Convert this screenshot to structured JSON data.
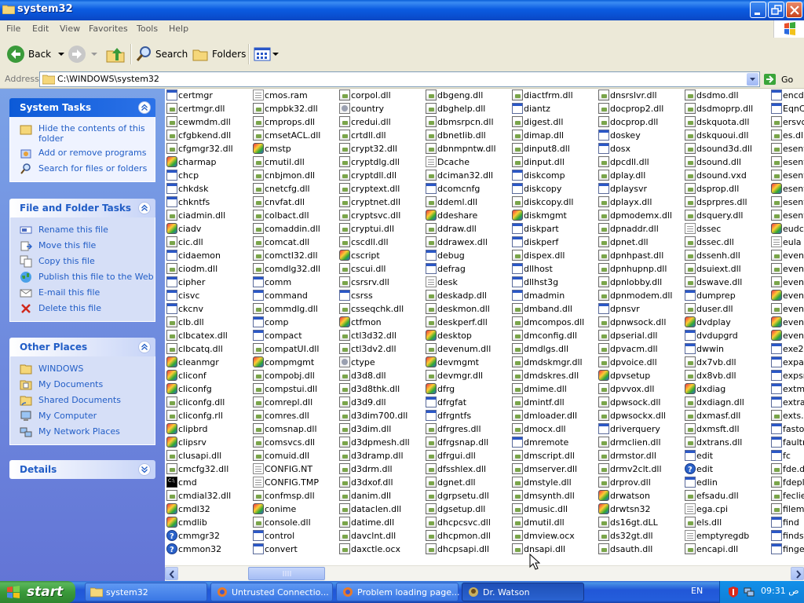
{
  "window": {
    "title": "system32"
  },
  "menu": [
    "File",
    "Edit",
    "View",
    "Favorites",
    "Tools",
    "Help"
  ],
  "toolbar": {
    "back": "Back",
    "search": "Search",
    "folders": "Folders"
  },
  "address": {
    "label": "Address",
    "path": "C:\\WINDOWS\\system32",
    "go": "Go"
  },
  "system_tasks": {
    "title": "System Tasks",
    "items": [
      "Hide the contents of this folder",
      "Add or remove programs",
      "Search for files or folders"
    ]
  },
  "file_folder_tasks": {
    "title": "File and Folder Tasks",
    "items": [
      "Rename this file",
      "Move this file",
      "Copy this file",
      "Publish this file to the Web",
      "E-mail this file",
      "Delete this file"
    ]
  },
  "other_places": {
    "title": "Other Places",
    "items": [
      "WINDOWS",
      "My Documents",
      "Shared Documents",
      "My Computer",
      "My Network Places"
    ]
  },
  "details": {
    "title": "Details"
  },
  "file_columns": [
    [
      [
        "certmgr",
        "exe"
      ],
      [
        "certmgr.dll",
        "dll"
      ],
      [
        "cewmdm.dll",
        "dll"
      ],
      [
        "cfgbkend.dll",
        "dll"
      ],
      [
        "cfgmgr32.dll",
        "dll"
      ],
      [
        "charmap",
        "app"
      ],
      [
        "chcp",
        "exe"
      ],
      [
        "chkdsk",
        "exe"
      ],
      [
        "chkntfs",
        "exe"
      ],
      [
        "ciadmin.dll",
        "dll"
      ],
      [
        "ciadv",
        "app"
      ],
      [
        "cic.dll",
        "dll"
      ],
      [
        "cidaemon",
        "exe"
      ],
      [
        "ciodm.dll",
        "dll"
      ],
      [
        "cipher",
        "exe"
      ],
      [
        "cisvc",
        "exe"
      ],
      [
        "ckcnv",
        "exe"
      ],
      [
        "clb.dll",
        "dll"
      ],
      [
        "clbcatex.dll",
        "dll"
      ],
      [
        "clbcatq.dll",
        "dll"
      ],
      [
        "cleanmgr",
        "app"
      ],
      [
        "cliconf",
        "app"
      ],
      [
        "cliconfg",
        "app"
      ],
      [
        "cliconfg.dll",
        "dll"
      ],
      [
        "cliconfg.rll",
        "dll"
      ],
      [
        "clipbrd",
        "app"
      ],
      [
        "clipsrv",
        "app"
      ],
      [
        "clusapi.dll",
        "dll"
      ],
      [
        "cmcfg32.dll",
        "dll"
      ],
      [
        "cmd",
        "cmd"
      ],
      [
        "cmdial32.dll",
        "dll"
      ],
      [
        "cmdl32",
        "app"
      ],
      [
        "cmdlib",
        "app"
      ],
      [
        "cmmgr32",
        "help"
      ],
      [
        "cmmon32",
        "help"
      ]
    ],
    [
      [
        "cmos.ram",
        "file"
      ],
      [
        "cmpbk32.dll",
        "dll"
      ],
      [
        "cmprops.dll",
        "dll"
      ],
      [
        "cmsetACL.dll",
        "dll"
      ],
      [
        "cmstp",
        "app"
      ],
      [
        "cmutil.dll",
        "dll"
      ],
      [
        "cnbjmon.dll",
        "dll"
      ],
      [
        "cnetcfg.dll",
        "dll"
      ],
      [
        "cnvfat.dll",
        "dll"
      ],
      [
        "colbact.dll",
        "dll"
      ],
      [
        "comaddin.dll",
        "dll"
      ],
      [
        "comcat.dll",
        "dll"
      ],
      [
        "comctl32.dll",
        "dll"
      ],
      [
        "comdlg32.dll",
        "dll"
      ],
      [
        "comm",
        "exe"
      ],
      [
        "command",
        "exe"
      ],
      [
        "commdlg.dll",
        "dll"
      ],
      [
        "comp",
        "exe"
      ],
      [
        "compact",
        "exe"
      ],
      [
        "compatUI.dll",
        "dll"
      ],
      [
        "compmgmt",
        "app"
      ],
      [
        "compobj.dll",
        "dll"
      ],
      [
        "compstui.dll",
        "dll"
      ],
      [
        "comrepl.dll",
        "dll"
      ],
      [
        "comres.dll",
        "dll"
      ],
      [
        "comsnap.dll",
        "dll"
      ],
      [
        "comsvcs.dll",
        "dll"
      ],
      [
        "comuid.dll",
        "dll"
      ],
      [
        "CONFIG.NT",
        "file"
      ],
      [
        "CONFIG.TMP",
        "file"
      ],
      [
        "confmsp.dll",
        "dll"
      ],
      [
        "conime",
        "app"
      ],
      [
        "console.dll",
        "dll"
      ],
      [
        "control",
        "exe"
      ],
      [
        "convert",
        "exe"
      ]
    ],
    [
      [
        "corpol.dll",
        "dll"
      ],
      [
        "country",
        "sys"
      ],
      [
        "credui.dll",
        "dll"
      ],
      [
        "crtdll.dll",
        "dll"
      ],
      [
        "crypt32.dll",
        "dll"
      ],
      [
        "cryptdlg.dll",
        "dll"
      ],
      [
        "cryptdll.dll",
        "dll"
      ],
      [
        "cryptext.dll",
        "dll"
      ],
      [
        "cryptnet.dll",
        "dll"
      ],
      [
        "cryptsvc.dll",
        "dll"
      ],
      [
        "cryptui.dll",
        "dll"
      ],
      [
        "cscdll.dll",
        "dll"
      ],
      [
        "cscript",
        "app"
      ],
      [
        "cscui.dll",
        "dll"
      ],
      [
        "csrsrv.dll",
        "dll"
      ],
      [
        "csrss",
        "exe"
      ],
      [
        "csseqchk.dll",
        "dll"
      ],
      [
        "ctfmon",
        "app"
      ],
      [
        "ctl3d32.dll",
        "dll"
      ],
      [
        "ctl3dv2.dll",
        "dll"
      ],
      [
        "ctype",
        "sys"
      ],
      [
        "d3d8.dll",
        "dll"
      ],
      [
        "d3d8thk.dll",
        "dll"
      ],
      [
        "d3d9.dll",
        "dll"
      ],
      [
        "d3dim700.dll",
        "dll"
      ],
      [
        "d3dim.dll",
        "dll"
      ],
      [
        "d3dpmesh.dll",
        "dll"
      ],
      [
        "d3dramp.dll",
        "dll"
      ],
      [
        "d3drm.dll",
        "dll"
      ],
      [
        "d3dxof.dll",
        "dll"
      ],
      [
        "danim.dll",
        "dll"
      ],
      [
        "dataclen.dll",
        "dll"
      ],
      [
        "datime.dll",
        "dll"
      ],
      [
        "davclnt.dll",
        "dll"
      ],
      [
        "daxctle.ocx",
        "dll"
      ]
    ],
    [
      [
        "dbgeng.dll",
        "dll"
      ],
      [
        "dbghelp.dll",
        "dll"
      ],
      [
        "dbmsrpcn.dll",
        "dll"
      ],
      [
        "dbnetlib.dll",
        "dll"
      ],
      [
        "dbnmpntw.dll",
        "dll"
      ],
      [
        "Dcache",
        "file"
      ],
      [
        "dciman32.dll",
        "dll"
      ],
      [
        "dcomcnfg",
        "exe"
      ],
      [
        "ddeml.dll",
        "dll"
      ],
      [
        "ddeshare",
        "app"
      ],
      [
        "ddraw.dll",
        "dll"
      ],
      [
        "ddrawex.dll",
        "dll"
      ],
      [
        "debug",
        "exe"
      ],
      [
        "defrag",
        "exe"
      ],
      [
        "desk",
        "file"
      ],
      [
        "deskadp.dll",
        "dll"
      ],
      [
        "deskmon.dll",
        "dll"
      ],
      [
        "deskperf.dll",
        "dll"
      ],
      [
        "desktop",
        "app"
      ],
      [
        "devenum.dll",
        "dll"
      ],
      [
        "devmgmt",
        "app"
      ],
      [
        "devmgr.dll",
        "dll"
      ],
      [
        "dfrg",
        "app"
      ],
      [
        "dfrgfat",
        "exe"
      ],
      [
        "dfrgntfs",
        "exe"
      ],
      [
        "dfrgres.dll",
        "dll"
      ],
      [
        "dfrgsnap.dll",
        "dll"
      ],
      [
        "dfrgui.dll",
        "dll"
      ],
      [
        "dfsshlex.dll",
        "dll"
      ],
      [
        "dgnet.dll",
        "dll"
      ],
      [
        "dgrpsetu.dll",
        "dll"
      ],
      [
        "dgsetup.dll",
        "dll"
      ],
      [
        "dhcpcsvc.dll",
        "dll"
      ],
      [
        "dhcpmon.dll",
        "dll"
      ],
      [
        "dhcpsapi.dll",
        "dll"
      ]
    ],
    [
      [
        "diactfrm.dll",
        "dll"
      ],
      [
        "diantz",
        "exe"
      ],
      [
        "digest.dll",
        "dll"
      ],
      [
        "dimap.dll",
        "dll"
      ],
      [
        "dinput8.dll",
        "dll"
      ],
      [
        "dinput.dll",
        "dll"
      ],
      [
        "diskcomp",
        "exe"
      ],
      [
        "diskcopy",
        "exe"
      ],
      [
        "diskcopy.dll",
        "dll"
      ],
      [
        "diskmgmt",
        "app"
      ],
      [
        "diskpart",
        "exe"
      ],
      [
        "diskperf",
        "exe"
      ],
      [
        "dispex.dll",
        "dll"
      ],
      [
        "dllhost",
        "exe"
      ],
      [
        "dllhst3g",
        "exe"
      ],
      [
        "dmadmin",
        "exe"
      ],
      [
        "dmband.dll",
        "dll"
      ],
      [
        "dmcompos.dll",
        "dll"
      ],
      [
        "dmconfig.dll",
        "dll"
      ],
      [
        "dmdlgs.dll",
        "dll"
      ],
      [
        "dmdskmgr.dll",
        "dll"
      ],
      [
        "dmdskres.dll",
        "dll"
      ],
      [
        "dmime.dll",
        "dll"
      ],
      [
        "dmintf.dll",
        "dll"
      ],
      [
        "dmloader.dll",
        "dll"
      ],
      [
        "dmocx.dll",
        "dll"
      ],
      [
        "dmremote",
        "exe"
      ],
      [
        "dmscript.dll",
        "dll"
      ],
      [
        "dmserver.dll",
        "dll"
      ],
      [
        "dmstyle.dll",
        "dll"
      ],
      [
        "dmsynth.dll",
        "dll"
      ],
      [
        "dmusic.dll",
        "dll"
      ],
      [
        "dmutil.dll",
        "dll"
      ],
      [
        "dmview.ocx",
        "dll"
      ],
      [
        "dnsapi.dll",
        "dll"
      ]
    ],
    [
      [
        "dnsrslvr.dll",
        "dll"
      ],
      [
        "docprop2.dll",
        "dll"
      ],
      [
        "docprop.dll",
        "dll"
      ],
      [
        "doskey",
        "exe"
      ],
      [
        "dosx",
        "exe"
      ],
      [
        "dpcdll.dll",
        "dll"
      ],
      [
        "dplay.dll",
        "dll"
      ],
      [
        "dplaysvr",
        "exe"
      ],
      [
        "dplayx.dll",
        "dll"
      ],
      [
        "dpmodemx.dll",
        "dll"
      ],
      [
        "dpnaddr.dll",
        "dll"
      ],
      [
        "dpnet.dll",
        "dll"
      ],
      [
        "dpnhpast.dll",
        "dll"
      ],
      [
        "dpnhupnp.dll",
        "dll"
      ],
      [
        "dpnlobby.dll",
        "dll"
      ],
      [
        "dpnmodem.dll",
        "dll"
      ],
      [
        "dpnsvr",
        "exe"
      ],
      [
        "dpnwsock.dll",
        "dll"
      ],
      [
        "dpserial.dll",
        "dll"
      ],
      [
        "dpvacm.dll",
        "dll"
      ],
      [
        "dpvoice.dll",
        "dll"
      ],
      [
        "dpvsetup",
        "app"
      ],
      [
        "dpvvox.dll",
        "dll"
      ],
      [
        "dpwsock.dll",
        "dll"
      ],
      [
        "dpwsockx.dll",
        "dll"
      ],
      [
        "driverquery",
        "exe"
      ],
      [
        "drmclien.dll",
        "dll"
      ],
      [
        "drmstor.dll",
        "dll"
      ],
      [
        "drmv2clt.dll",
        "dll"
      ],
      [
        "drprov.dll",
        "dll"
      ],
      [
        "drwatson",
        "app"
      ],
      [
        "drwtsn32",
        "app"
      ],
      [
        "ds16gt.dLL",
        "dll"
      ],
      [
        "ds32gt.dll",
        "dll"
      ],
      [
        "dsauth.dll",
        "dll"
      ]
    ],
    [
      [
        "dsdmo.dll",
        "dll"
      ],
      [
        "dsdmoprp.dll",
        "dll"
      ],
      [
        "dskquota.dll",
        "dll"
      ],
      [
        "dskquoui.dll",
        "dll"
      ],
      [
        "dsound3d.dll",
        "dll"
      ],
      [
        "dsound.dll",
        "dll"
      ],
      [
        "dsound.vxd",
        "dll"
      ],
      [
        "dsprop.dll",
        "dll"
      ],
      [
        "dsprpres.dll",
        "dll"
      ],
      [
        "dsquery.dll",
        "dll"
      ],
      [
        "dssec",
        "file"
      ],
      [
        "dssec.dll",
        "dll"
      ],
      [
        "dssenh.dll",
        "dll"
      ],
      [
        "dsuiext.dll",
        "dll"
      ],
      [
        "dswave.dll",
        "dll"
      ],
      [
        "dumprep",
        "exe"
      ],
      [
        "duser.dll",
        "dll"
      ],
      [
        "dvdplay",
        "app"
      ],
      [
        "dvdupgrd",
        "exe"
      ],
      [
        "dwwin",
        "exe"
      ],
      [
        "dx7vb.dll",
        "dll"
      ],
      [
        "dx8vb.dll",
        "dll"
      ],
      [
        "dxdiag",
        "app"
      ],
      [
        "dxdiagn.dll",
        "dll"
      ],
      [
        "dxmasf.dll",
        "dll"
      ],
      [
        "dxmsft.dll",
        "dll"
      ],
      [
        "dxtrans.dll",
        "dll"
      ],
      [
        "edit",
        "exe"
      ],
      [
        "edit",
        "help"
      ],
      [
        "edlin",
        "exe"
      ],
      [
        "efsadu.dll",
        "dll"
      ],
      [
        "ega.cpi",
        "file"
      ],
      [
        "els.dll",
        "dll"
      ],
      [
        "emptyregdb",
        "file"
      ],
      [
        "encapi.dll",
        "dll"
      ]
    ],
    [
      [
        "encde",
        "exe"
      ],
      [
        "EqnCl",
        "exe"
      ],
      [
        "ersvc",
        "dll"
      ],
      [
        "es.dll",
        "dll"
      ],
      [
        "esent",
        "dll"
      ],
      [
        "esent",
        "dll"
      ],
      [
        "esent",
        "dll"
      ],
      [
        "esent",
        "app"
      ],
      [
        "esent",
        "dll"
      ],
      [
        "esent",
        "dll"
      ],
      [
        "eudce",
        "app"
      ],
      [
        "eula",
        "file"
      ],
      [
        "event",
        "dll"
      ],
      [
        "event",
        "dll"
      ],
      [
        "event",
        "dll"
      ],
      [
        "event",
        "app"
      ],
      [
        "event",
        "dll"
      ],
      [
        "event",
        "app"
      ],
      [
        "event",
        "app"
      ],
      [
        "exe2b",
        "exe"
      ],
      [
        "expar",
        "exe"
      ],
      [
        "expsr",
        "exe"
      ],
      [
        "extmg",
        "exe"
      ],
      [
        "extrac",
        "exe"
      ],
      [
        "exts.c",
        "dll"
      ],
      [
        "fastop",
        "exe"
      ],
      [
        "faultr",
        "exe"
      ],
      [
        "fc",
        "exe"
      ],
      [
        "fde.dl",
        "dll"
      ],
      [
        "fdeplo",
        "dll"
      ],
      [
        "feclien",
        "dll"
      ],
      [
        "filemg",
        "dll"
      ],
      [
        "find",
        "exe"
      ],
      [
        "findstr",
        "exe"
      ],
      [
        "finger",
        "exe"
      ]
    ]
  ],
  "taskbar": {
    "start": "start",
    "tasks": [
      "system32",
      "Untrusted Connectio...",
      "Problem loading page...",
      "Dr. Watson"
    ],
    "lang": "EN",
    "clock": "09:31 ص"
  }
}
